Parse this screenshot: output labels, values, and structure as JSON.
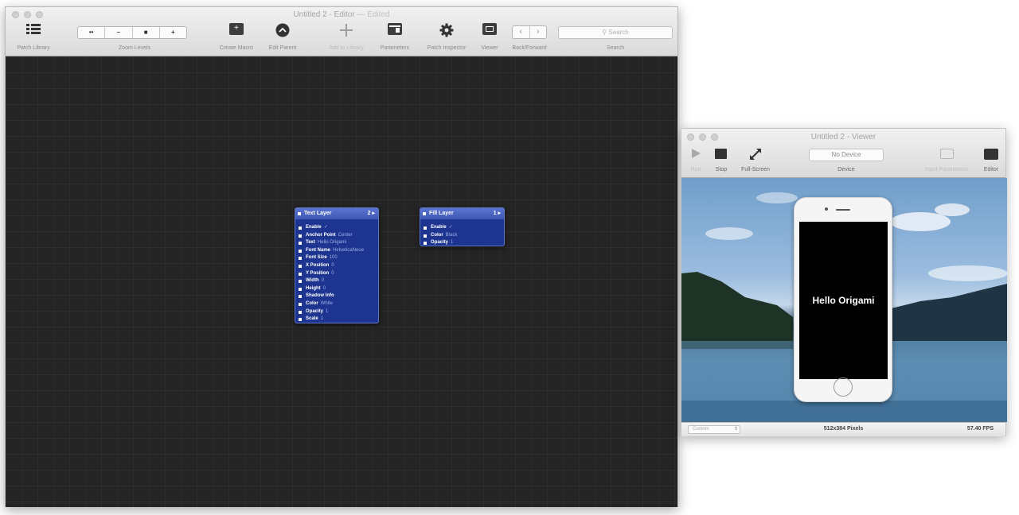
{
  "editor": {
    "title": "Untitled 2 - Editor",
    "edited": "— Edited",
    "toolbar": {
      "patch_library": "Patch Library",
      "zoom_levels": "Zoom Levels",
      "zoom_buttons": [
        "••",
        "–",
        "■",
        "+"
      ],
      "create_macro": "Create Macro",
      "edit_parent": "Edit Parent",
      "add_to_library": "Add to Library",
      "parameters": "Parameters",
      "patch_inspector": "Patch Inspector",
      "viewer": "Viewer",
      "back_forward": "Back/Forward",
      "search_placeholder": "Search",
      "search_label": "Search"
    },
    "patches": {
      "text_layer": {
        "title": "Text Layer",
        "number": "2",
        "ports": [
          {
            "name": "Enable",
            "value": "✓"
          },
          {
            "name": "Anchor Point",
            "value": "Center"
          },
          {
            "name": "Text",
            "value": "Hello Origami"
          },
          {
            "name": "Font Name",
            "value": "HelveticaNeue"
          },
          {
            "name": "Font Size",
            "value": "100"
          },
          {
            "name": "X Position",
            "value": "0"
          },
          {
            "name": "Y Position",
            "value": "0"
          },
          {
            "name": "Width",
            "value": "0"
          },
          {
            "name": "Height",
            "value": "0"
          },
          {
            "name": "Shadow Info",
            "value": ""
          },
          {
            "name": "Color",
            "value": "White"
          },
          {
            "name": "Opacity",
            "value": "1"
          },
          {
            "name": "Scale",
            "value": "1"
          }
        ]
      },
      "fill_layer": {
        "title": "Fill Layer",
        "number": "1",
        "ports": [
          {
            "name": "Enable",
            "value": "✓"
          },
          {
            "name": "Color",
            "value": "Black"
          },
          {
            "name": "Opacity",
            "value": "1"
          }
        ]
      }
    }
  },
  "viewer": {
    "title": "Untitled 2 - Viewer",
    "toolbar": {
      "run": "Run",
      "stop": "Stop",
      "full_screen": "Full-Screen",
      "device_value": "No Device",
      "device_label": "Device",
      "input_parameters": "Input Parameters",
      "editor": "Editor"
    },
    "screen_text": "Hello Origami",
    "status": {
      "select_value": "Custom",
      "resolution": "512x384 Pixels",
      "fps": "57.40 FPS"
    }
  }
}
